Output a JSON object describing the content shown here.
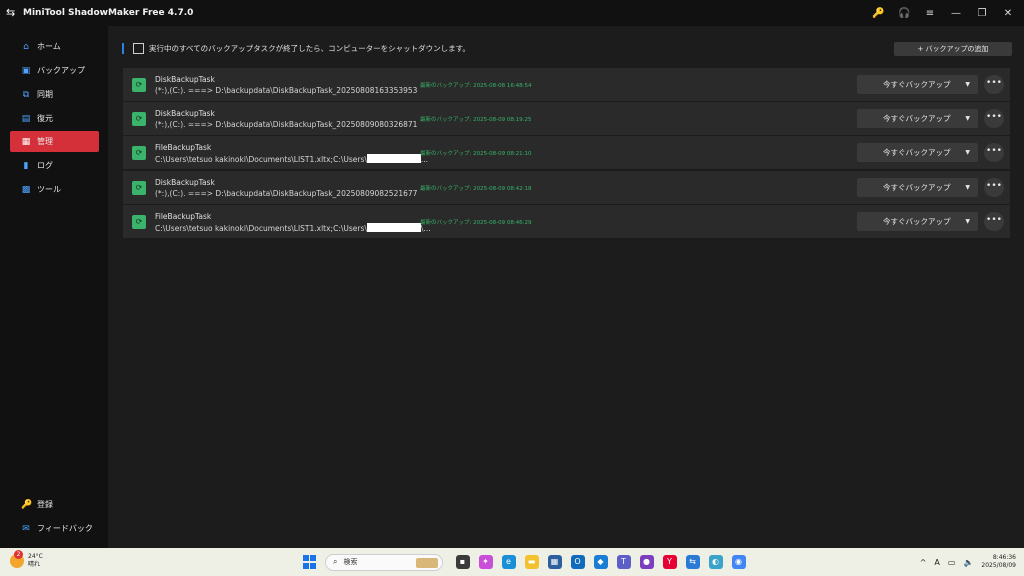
{
  "app": {
    "title": "MiniTool ShadowMaker Free 4.7.0",
    "title_icons": [
      "key-icon",
      "headset-icon",
      "menu-icon",
      "minimize-icon",
      "restore-icon",
      "close-icon"
    ]
  },
  "sidebar": {
    "items": [
      {
        "label": "ホーム",
        "icon": "home-icon"
      },
      {
        "label": "バックアップ",
        "icon": "backup-icon"
      },
      {
        "label": "同期",
        "icon": "sync-icon"
      },
      {
        "label": "復元",
        "icon": "restore-data-icon"
      },
      {
        "label": "管理",
        "icon": "manage-icon",
        "active": true
      },
      {
        "label": "ログ",
        "icon": "log-icon"
      },
      {
        "label": "ツール",
        "icon": "tools-icon"
      }
    ],
    "bottom": [
      {
        "label": "登録",
        "icon": "register-key-icon"
      },
      {
        "label": "フィードバック",
        "icon": "feedback-mail-icon"
      }
    ]
  },
  "main": {
    "shutdown_label": "実行中のすべてのバックアップタスクが終了したら、コンピューターをシャットダウンします。",
    "add_backup_label": "+ バックアップの追加",
    "tasks": [
      {
        "name": "DiskBackupTask",
        "path": "(*:),(C:). ===> D:\\backupdata\\DiskBackupTask_20250808163353953",
        "redacted": false,
        "path_suffix": "",
        "last": "最新のバックアップ: 2025-08-08 16:48:54"
      },
      {
        "name": "DiskBackupTask",
        "path": "(*:),(C:). ===> D:\\backupdata\\DiskBackupTask_20250809080326871",
        "redacted": false,
        "path_suffix": "",
        "last": "最新のバックアップ: 2025-08-09 08:19:25"
      },
      {
        "name": "FileBackupTask",
        "path": "C:\\Users\\tetsuo kakinoki\\Documents\\LIST1.xltx;C:\\Users\\",
        "redacted": true,
        "path_suffix": "...",
        "last": "最新のバックアップ: 2025-08-09 08:21:10"
      },
      {
        "name": "DiskBackupTask",
        "path": "(*:),(C:). ===> D:\\backupdata\\DiskBackupTask_20250809082521677",
        "redacted": false,
        "path_suffix": "",
        "last": "最新のバックアップ: 2025-08-09 08:42:18"
      },
      {
        "name": "FileBackupTask",
        "path": "C:\\Users\\tetsuo kakinoki\\Documents\\LIST1.xltx;C:\\Users\\",
        "redacted": true,
        "path_suffix": "\\...",
        "last": "最新のバックアップ: 2025-08-09 08:46:29"
      }
    ],
    "backup_now_label": "今すぐバックアップ",
    "more_label": "•••"
  },
  "taskbar": {
    "weather_badge": "2",
    "temperature": "24°C",
    "condition": "晴れ",
    "search_label": "検索",
    "time": "8:46:36",
    "date": "2025/08/09",
    "ime": "A"
  },
  "colors": {
    "accent_active": "#d3303a",
    "task_icon": "#3cb36b",
    "last_backup_text": "#37b46a",
    "nav_icon": "#4ea3ff"
  }
}
